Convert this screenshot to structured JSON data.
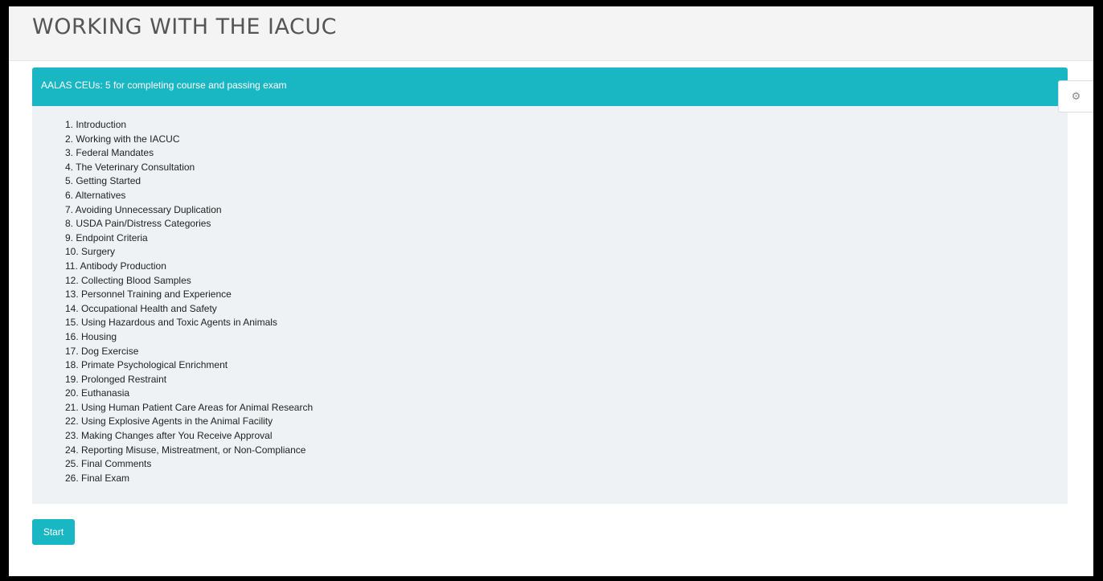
{
  "page": {
    "title": "WORKING WITH THE IACUC"
  },
  "panel": {
    "heading": "AALAS CEUs: 5 for completing course and passing exam",
    "modules": [
      "1. Introduction",
      "2. Working with the IACUC",
      "3. Federal Mandates",
      "4. The Veterinary Consultation",
      "5. Getting Started",
      "6. Alternatives",
      "7. Avoiding Unnecessary Duplication",
      "8. USDA Pain/Distress Categories",
      "9. Endpoint Criteria",
      "10. Surgery",
      "11. Antibody Production",
      "12. Collecting Blood Samples",
      "13. Personnel Training and Experience",
      "14. Occupational Health and Safety",
      "15. Using Hazardous and Toxic Agents in Animals",
      "16. Housing",
      "17. Dog Exercise",
      "18. Primate Psychological Enrichment",
      "19. Prolonged Restraint",
      "20. Euthanasia",
      "21. Using Human Patient Care Areas for Animal Research",
      "22. Using Explosive Agents in the Animal Facility",
      "23. Making Changes after You Receive Approval",
      "24. Reporting Misuse, Mistreatment, or Non-Compliance",
      "25. Final Comments",
      "26. Final Exam"
    ]
  },
  "actions": {
    "start_label": "Start"
  },
  "settings": {
    "icon": "gear-icon"
  },
  "colors": {
    "accent": "#19b6c3",
    "panel_background": "#eef2f4",
    "header_background": "#f4f4f4"
  }
}
